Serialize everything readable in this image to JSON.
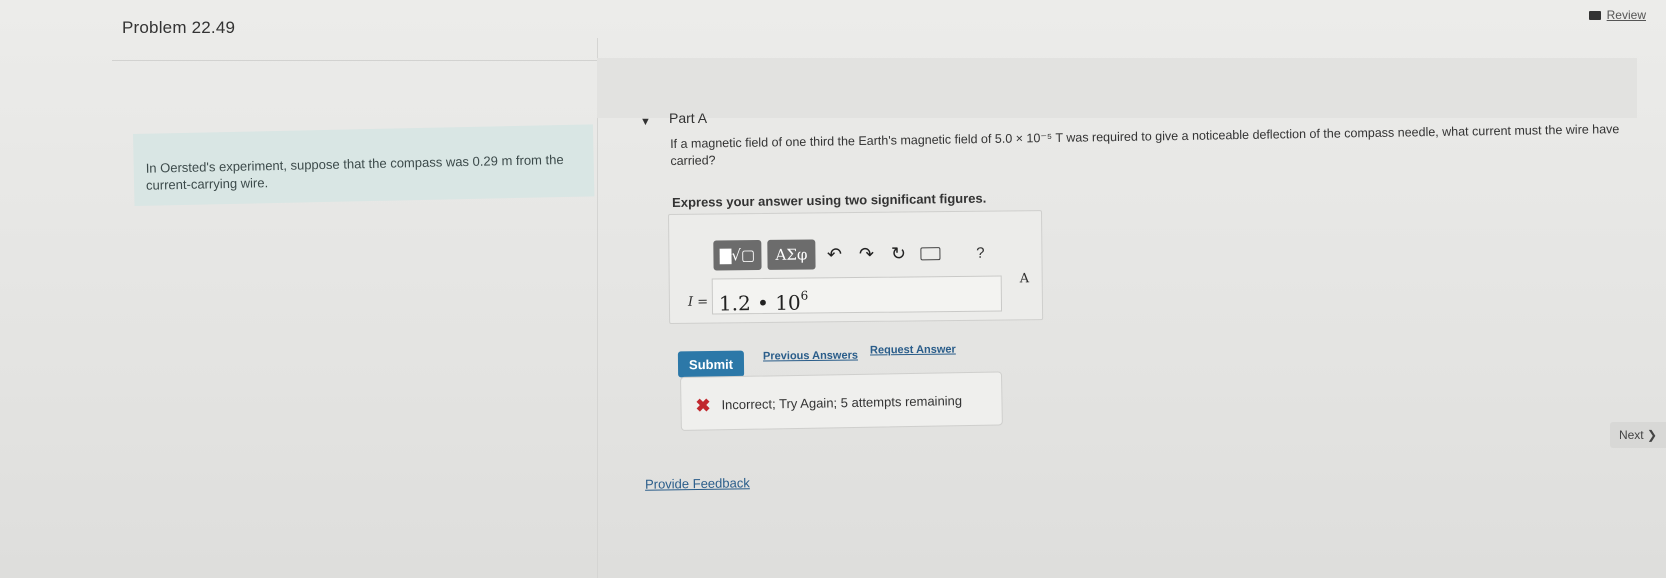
{
  "header": {
    "problem_title": "Problem 22.49",
    "review_label": "Review"
  },
  "intro": {
    "text": "In Oersted's experiment, suppose that the compass was 0.29 m from the current-carrying wire."
  },
  "part": {
    "label": "Part A",
    "question": "If a magnetic field of one third the Earth's magnetic field of 5.0 × 10⁻⁵ T was required to give a noticeable deflection of the compass needle, what current must the wire have carried?",
    "instruction": "Express your answer using two significant figures."
  },
  "toolbar": {
    "templates_label": "▇√▢",
    "greek_label": "ΑΣφ",
    "undo_glyph": "↶",
    "redo_glyph": "↷",
    "reset_glyph": "↻",
    "help_glyph": "?"
  },
  "answer": {
    "variable": "I =",
    "value_mantissa": "1.2 • 10",
    "value_exponent": "6",
    "unit": "A"
  },
  "actions": {
    "submit_label": "Submit",
    "previous_answers_label": "Previous Answers",
    "request_answer_label": "Request Answer"
  },
  "feedback": {
    "icon": "✖",
    "message": "Incorrect; Try Again; 5 attempts remaining"
  },
  "footer": {
    "provide_feedback_label": "Provide Feedback",
    "next_label": "Next ❯"
  }
}
